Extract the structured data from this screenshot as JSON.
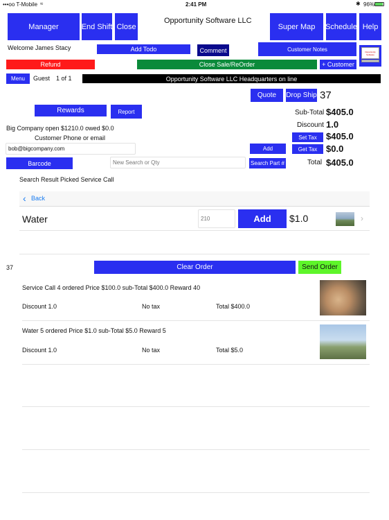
{
  "status_bar": {
    "carrier": "•••oo T-Mobile",
    "time": "2:41 PM",
    "battery": "96%"
  },
  "header": {
    "company": "Opportunity Software LLC",
    "manager": "Manager",
    "end_shift": "End Shift",
    "close": "Close",
    "super_map": "Super Map",
    "schedule": "Schedule",
    "help": "Help",
    "logo_text": "Opportunity Software"
  },
  "welcome": "Welcome James Stacy",
  "add_todo": "Add Todo",
  "comment": "Comment",
  "customer_notes": "Customer Notes",
  "refund": "Refund",
  "close_sale": "Close Sale/ReOrder",
  "add_customer": "+ Customer",
  "menu": "Menu",
  "guest": "Guest",
  "pager": "1 of 1",
  "marquee": "Opportunity Software LLC Headquarters on line",
  "quote": "Quote",
  "drop_ship": "Drop Ship",
  "order_count": "37",
  "rewards": "Rewards",
  "report": "Report",
  "customer_info": "Big Company  open $1210.0 owed $0.0",
  "phone_label": "Customer Phone or email",
  "email_value": "bob@bigcompany.com",
  "add": "Add",
  "barcode": "Barcode",
  "search_placeholder": "New Search or Qty",
  "search_part": "Search Part #",
  "totals": {
    "subtotal_label": "Sub-Total",
    "subtotal_value": "$405.0",
    "discount_label": "Discount",
    "discount_value": "1.0",
    "set_tax": "Set Tax",
    "tax_set_value": "$405.0",
    "get_tax": "Get Tax",
    "tax_value": "$0.0",
    "total_label": "Total",
    "total_value": "$405.0"
  },
  "search_result": "Search Result Picked Service Call",
  "back": "Back",
  "product": {
    "name": "Water",
    "qty_placeholder": "210",
    "add": "Add",
    "price": "$1.0"
  },
  "order_number": "37",
  "clear_order": "Clear Order",
  "send_order": "Send Order",
  "order_items": [
    {
      "summary": "Service Call   4 ordered    Price $100.0   sub-Total $400.0  Reward 40",
      "discount": "Discount 1.0",
      "tax": "No tax",
      "total": "Total $400.0"
    },
    {
      "summary": "Water   5 ordered    Price $1.0   sub-Total $5.0  Reward 5",
      "discount": "Discount 1.0",
      "tax": "No tax",
      "total": "Total $5.0"
    }
  ],
  "colors": {
    "blue": "#2a2ff0",
    "navy": "#0a0a8c",
    "red": "#ff1a1a",
    "green": "#0a8a3a",
    "lime": "#5ef52a",
    "black": "#000000"
  }
}
